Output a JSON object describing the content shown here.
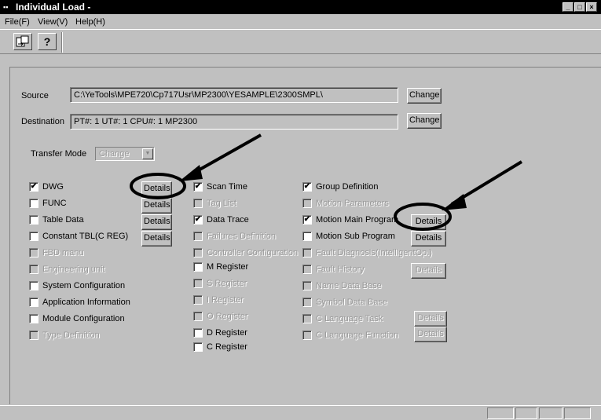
{
  "window": {
    "title": "Individual Load -",
    "icon": "app-icon",
    "controls": [
      "minimize-icon",
      "maximize-icon",
      "close-icon"
    ]
  },
  "menu": {
    "file": "File(F)",
    "view": "View(V)",
    "help": "Help(H)"
  },
  "toolbar": {
    "icons": [
      "load-icon",
      "help-question-icon"
    ]
  },
  "form": {
    "source_label": "Source",
    "source_value": "C:\\YeTools\\MPE720\\Cp717Usr\\MP2300\\YESAMPLE\\2300SMPL\\",
    "destination_label": "Destination",
    "destination_value": "PT#: 1 UT#: 1 CPU#: 1    MP2300",
    "change_label": "Change",
    "transfer_mode_label": "Transfer Mode",
    "transfer_mode_value": "Change",
    "details_label": "Details"
  },
  "items": {
    "col1": [
      {
        "label": "DWG",
        "checked": "✔"
      },
      {
        "label": "FUNC",
        "checked": ""
      },
      {
        "label": "Table Data",
        "checked": ""
      },
      {
        "label": "Constant TBL(C REG)",
        "checked": ""
      },
      {
        "label": "FBD manu",
        "checked": ""
      },
      {
        "label": "Engineering unit",
        "checked": ""
      },
      {
        "label": "System Configuration",
        "checked": ""
      },
      {
        "label": "Application Information",
        "checked": ""
      },
      {
        "label": "Module Configuration",
        "checked": ""
      },
      {
        "label": "Type Definition",
        "checked": ""
      }
    ],
    "col2": [
      {
        "label": "Scan Time",
        "checked": "✔"
      },
      {
        "label": "Tag List",
        "checked": ""
      },
      {
        "label": "Data Trace",
        "checked": "✔"
      },
      {
        "label": "Failures Definition",
        "checked": ""
      },
      {
        "label": "Controller Configuration",
        "checked": ""
      },
      {
        "label": "M Register",
        "checked": ""
      },
      {
        "label": "S Register",
        "checked": ""
      },
      {
        "label": "I Register",
        "checked": ""
      },
      {
        "label": "O Register",
        "checked": ""
      },
      {
        "label": "D Register",
        "checked": ""
      },
      {
        "label": "C Register",
        "checked": ""
      }
    ],
    "col3": [
      {
        "label": "Group Definition",
        "checked": "✔"
      },
      {
        "label": "Motion Parameters",
        "checked": ""
      },
      {
        "label": "Motion Main Program",
        "checked": "✔"
      },
      {
        "label": "Motion Sub Program",
        "checked": ""
      },
      {
        "label": "Fault Diagnosis(IntelligentOp.)",
        "checked": ""
      },
      {
        "label": "Fault History",
        "checked": ""
      },
      {
        "label": "Name Data Base",
        "checked": ""
      },
      {
        "label": "Symbol Data Base",
        "checked": ""
      },
      {
        "label": "C Language Task",
        "checked": ""
      },
      {
        "label": "C Language Function",
        "checked": ""
      }
    ]
  },
  "colors": {
    "window_bg": "#c0c0c0",
    "titlebar_bg": "#000000",
    "disabled_text": "#9a9a9a",
    "annotation": "#000000"
  }
}
